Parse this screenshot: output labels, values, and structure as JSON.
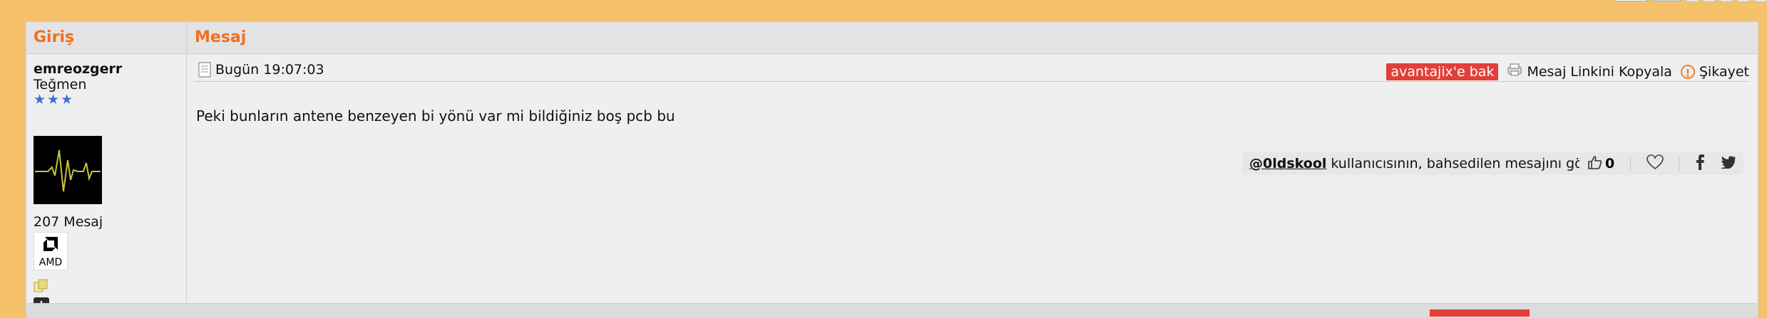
{
  "thread": {
    "header": {
      "giris": "Giriş",
      "mesaj": "Mesaj"
    }
  },
  "post": {
    "author": {
      "username": "emreozgerr",
      "rank": "Teğmen",
      "stars": 3,
      "message_count": "207 Mesaj",
      "badge_label": "AMD"
    },
    "timestamp": "Bugün 19:07:03",
    "actions": {
      "deal": "avantajix'e bak",
      "copy_link": "Mesaj Linkini Kopyala",
      "report": "Şikayet"
    },
    "body": "Peki bunların antene benzeyen bi yönü var mi bildiğiniz boş pcb bu",
    "mention": {
      "user": "@0ldskool",
      "text": "kullanıcısının, bahsedilen mesajını gör"
    },
    "likes": "0"
  },
  "colors": {
    "page_bg": "#f5c26b",
    "header_text": "#f07020",
    "deal_button": "#e04038",
    "star": "#3f6fd6"
  }
}
